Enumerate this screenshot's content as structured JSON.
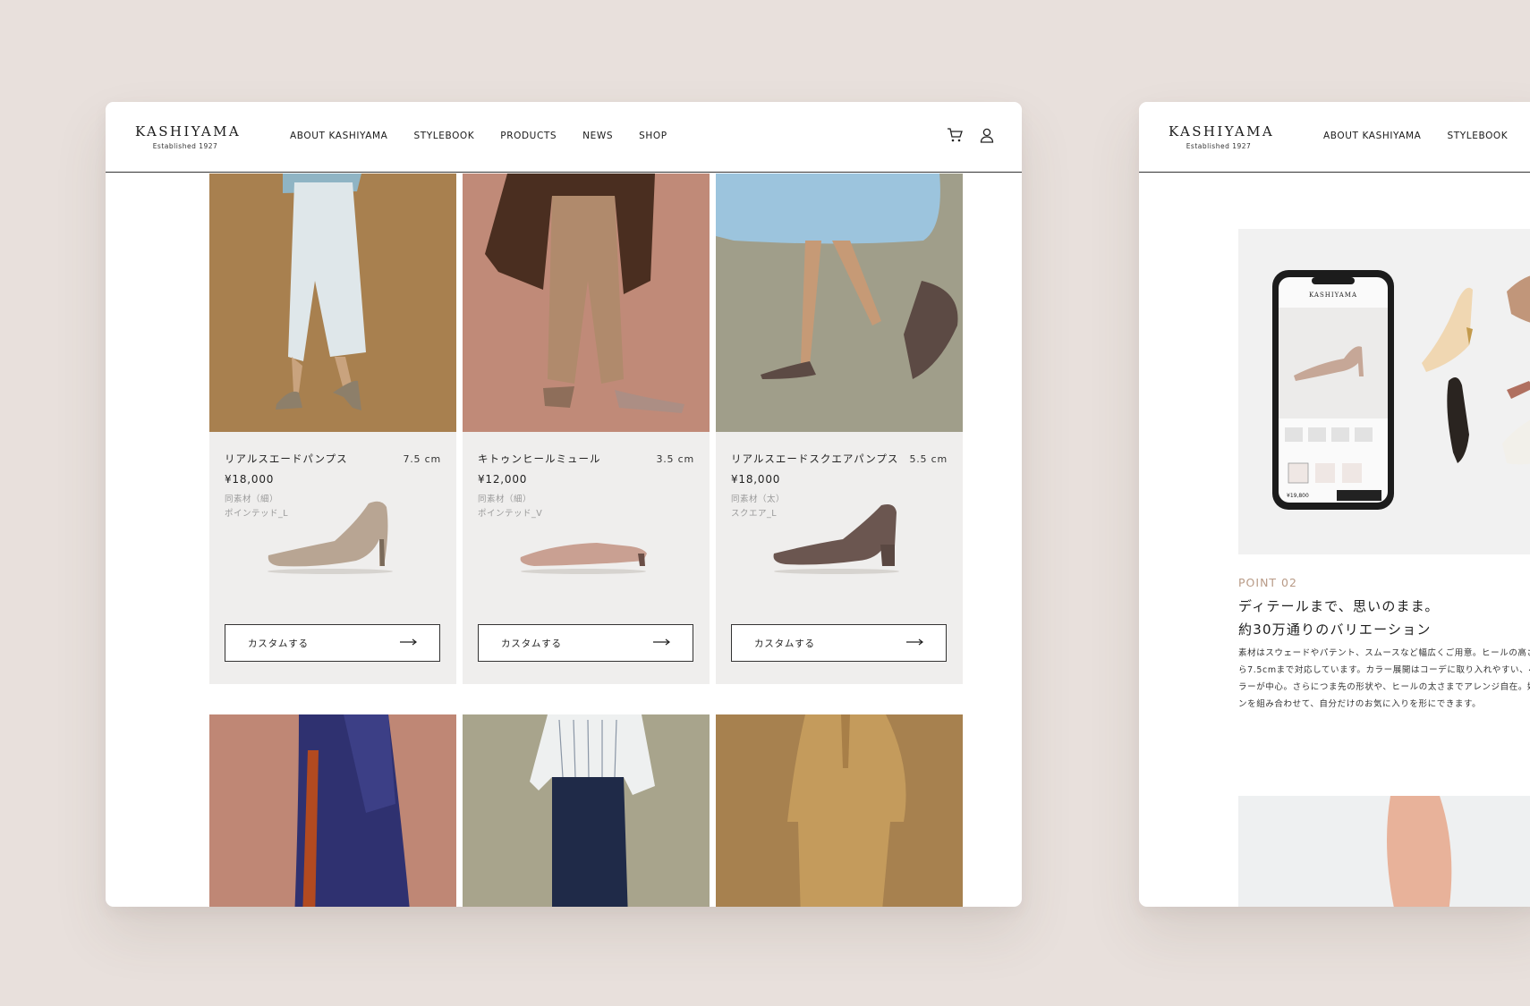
{
  "brand": {
    "name": "KASHIYAMA",
    "established": "Established 1927"
  },
  "nav": {
    "items": [
      {
        "label": "ABOUT KASHIYAMA"
      },
      {
        "label": "STYLEBOOK"
      },
      {
        "label": "PRODUCTS"
      },
      {
        "label": "NEWS"
      },
      {
        "label": "SHOP"
      }
    ]
  },
  "header_icons": [
    "cart-icon",
    "user-icon"
  ],
  "products": [
    {
      "name": "リアルスエードパンプス",
      "heel": "7.5 cm",
      "price": "¥18,000",
      "material": "同素材（細）",
      "toe": "ポインテッド_L",
      "button": "カスタムする",
      "photo_bg": "#a8804f",
      "shoe_color": "#b8a593"
    },
    {
      "name": "キトゥンヒールミュール",
      "heel": "3.5 cm",
      "price": "¥12,000",
      "material": "同素材（細）",
      "toe": "ポインテッド_V",
      "button": "カスタムする",
      "photo_bg": "#c08a78",
      "shoe_color": "#c9a092"
    },
    {
      "name": "リアルスエードスクエアパンプス",
      "heel": "5.5 cm",
      "price": "¥18,000",
      "material": "同素材（太）",
      "toe": "スクエア_L",
      "button": "カスタムする",
      "photo_bg": "#a09e8a",
      "shoe_color": "#6b5650"
    }
  ],
  "lookbook_row": [
    {
      "photo_bg": "#bf8775"
    },
    {
      "photo_bg": "#a8a48c"
    },
    {
      "photo_bg": "#a7814f"
    }
  ],
  "side_page": {
    "nav": [
      {
        "label": "ABOUT KASHIYAMA"
      },
      {
        "label": "STYLEBOOK"
      }
    ],
    "phone_logo": "KASHIYAMA",
    "phone_price": "¥19,800",
    "point_label": "POINT 02",
    "point_title_1": "ディテールまで、思いのまま。",
    "point_title_2": "約30万通りのバリエーション",
    "point_body": [
      "素材はスウェードやパテント、スムースなど幅広くご用意。ヒールの高さは",
      "ら7.5cmまで対応しています。カラー展開はコーデに取り入れやすい、ベーシ",
      "ラーが中心。さらにつま先の形状や、ヒールの太さまでアレンジ自在。好き",
      "ンを組み合わせて、自分だけのお気に入りを形にできます。"
    ]
  },
  "colors": {
    "background": "#e8e0dc",
    "card": "#efeeed",
    "accent": "#b89a86"
  }
}
